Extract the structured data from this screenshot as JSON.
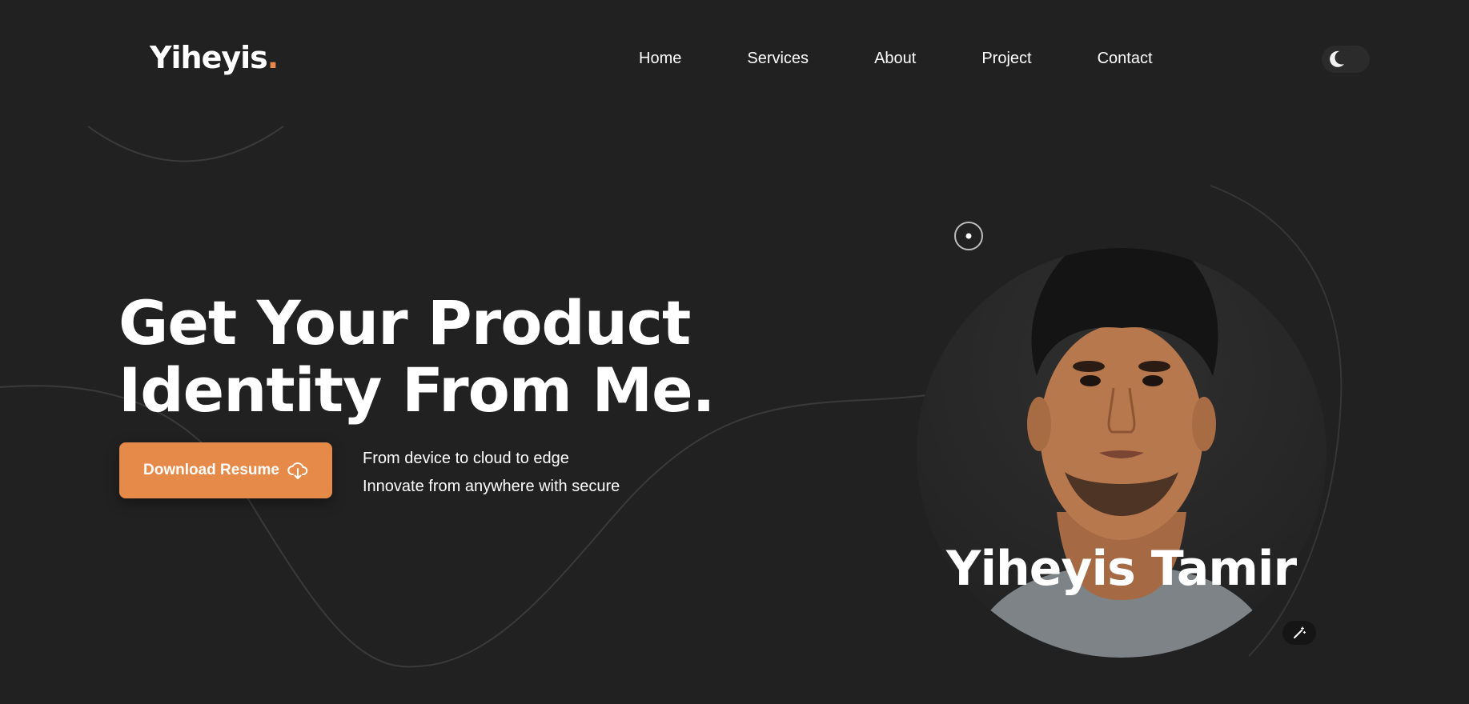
{
  "brand": {
    "name": "Yiheyis",
    "dot": ".",
    "accent_color": "#e8894a"
  },
  "nav": {
    "items": [
      {
        "label": "Home"
      },
      {
        "label": "Services"
      },
      {
        "label": "About"
      },
      {
        "label": "Project"
      },
      {
        "label": "Contact"
      }
    ]
  },
  "theme_toggle": {
    "icon": "moon-icon"
  },
  "hero": {
    "title_line1": "Get Your Product",
    "title_line2": "Identity From Me.",
    "cta_label": "Download Resume",
    "cta_icon": "cloud-download-icon",
    "tagline_line1": "From device to cloud to edge",
    "tagline_line2": "Innovate from anywhere with secure"
  },
  "profile": {
    "name": "Yiheyis Tamir",
    "photo": "portrait-photo",
    "record_icon": "record-icon",
    "wand_icon": "magic-wand-icon"
  },
  "colors": {
    "background": "#212121",
    "button": "#e68a49",
    "text": "#ffffff"
  }
}
